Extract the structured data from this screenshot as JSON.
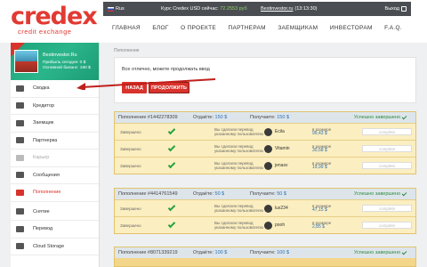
{
  "logo": {
    "main": "credex",
    "sub": "credit exchange"
  },
  "topbar": {
    "lang": "Rus",
    "rate_label": "Курс Credex USD сейчас:",
    "rate_value": "72.2553 руб",
    "user": "Bestinvestor.ru",
    "user_time": "(13:13:30)",
    "logout": "Выход"
  },
  "nav": [
    "ГЛАВНАЯ",
    "БЛОГ",
    "О ПРОЕКТЕ",
    "ПАРТНЕРАМ",
    "ЗАЕМЩИКАМ",
    "ИНВЕСТОРАМ",
    "F.A.Q."
  ],
  "profile": {
    "name": "Bestinvestor.Ru",
    "line1": "Прибыль сегодня: 0 $",
    "line2": "Основной баланс: 160 $"
  },
  "sidebar": [
    {
      "label": "Сводка",
      "state": "normal"
    },
    {
      "label": "Кредитор",
      "state": "normal"
    },
    {
      "label": "Заемщик",
      "state": "normal"
    },
    {
      "label": "Партнерка",
      "state": "normal"
    },
    {
      "label": "Карьер",
      "state": "disabled"
    },
    {
      "label": "Сообщения",
      "state": "normal"
    },
    {
      "label": "Пополнение",
      "state": "active"
    },
    {
      "label": "Снятие",
      "state": "normal"
    },
    {
      "label": "Перевод",
      "state": "normal"
    },
    {
      "label": "Cloud Storage",
      "state": "normal"
    }
  ],
  "breadcrumb": "Пополнение",
  "panel": {
    "message": "Все отлично, можете продолжать ввод",
    "back_button": "НАЗАД",
    "next_button": "ПРОДОЛЖИТЬ"
  },
  "blocks": [
    {
      "title": "Пополнение #1442278309",
      "give_label": "Отдаёте:",
      "give": "150 $",
      "get_label": "Получаете:",
      "get": "150 $",
      "status": "Успешно завершено",
      "rows": [
        {
          "status": "Завершено",
          "msg": "Вы сделали перевод указанному пользователю",
          "name": "Ecila",
          "amount_label": "в размере",
          "amount": "99,43 $",
          "progress": "complete"
        },
        {
          "status": "Завершено",
          "msg": "Вы сделали перевод указанному пользователю",
          "name": "Vitamin",
          "amount_label": "в размере",
          "amount": "30,58 $",
          "progress": "complete"
        },
        {
          "status": "Завершено",
          "msg": "Вы сделали перевод указанному пользователю",
          "name": "jenasv",
          "amount_label": "в размере",
          "amount": "19,99 $",
          "progress": "complete"
        }
      ]
    },
    {
      "title": "Пополнение #4414761549",
      "give_label": "Отдаёте:",
      "give": "50 $",
      "get_label": "Получаете:",
      "get": "50 $",
      "status": "Успешно завершено",
      "rows": [
        {
          "status": "Завершено",
          "msg": "Вы сделали перевод указанному пользователю",
          "name": "lux234",
          "amount_label": "в размере",
          "amount": "47,15 $",
          "progress": "complete"
        },
        {
          "status": "Завершено",
          "msg": "Вы сделали перевод указанному пользователю",
          "name": "pooh",
          "amount_label": "в размере",
          "amount": "2,85 $",
          "progress": "complete"
        }
      ]
    },
    {
      "title": "Пополнение #8071339219",
      "give_label": "Отдаёте:",
      "give": "100 $",
      "get_label": "Получаете:",
      "get": "100 $",
      "status": "Успешно завершено",
      "rows": []
    }
  ]
}
